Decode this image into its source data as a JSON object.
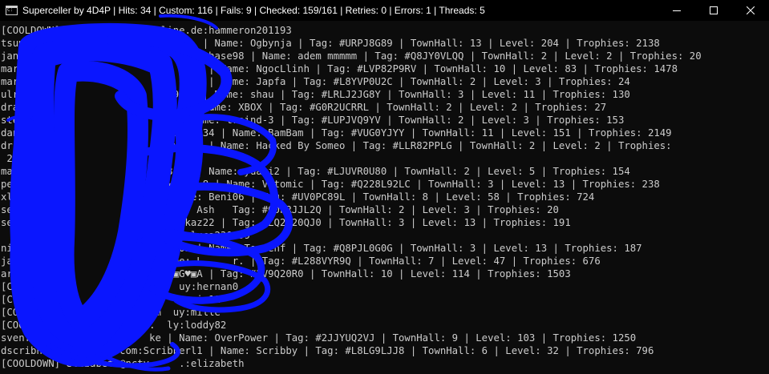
{
  "window": {
    "title": "Superceller by 4D4P | Hits: 34 | Custom: 116 | Fails: 9 | Checked: 159/161 | Retries: 0 | Errors: 1 | Threads: 5",
    "icon": "console-app-icon",
    "controls": [
      "minimize-icon",
      "maximize-icon",
      "close-icon"
    ]
  },
  "console": {
    "text_color": "#cccccc",
    "background": "#0c0c0c",
    "lines": [
      "[COOLDOWN] mar        0t-online.de:hammeron201193",
      "tsum                              | Name: Ogbynja | Tag: #URPJ8G89 | TownHall: 13 | Level: 204 | Trophies: 2138",
      "janni                           perhase98 | Name: adem mmmmm | Tag: #Q8JY0VLQQ | TownHall: 2 | Level: 2 | Trophies: 20",
      "marce                           :1 | Name: NgocLlinh | Tag: #LVP82P9RV | TownHall: 10 | Level: 83 | Trophies: 1478",
      "marce                         0909 | Name: Japfa | Tag: #L8YVP0U2C | TownHall: 2 | Level: 3 | Trophies: 24",
      "ulric                        9815 | Name: shau | Tag: #LRLJ2JG8Y | TownHall: 3 | Level: 11 | Trophies: 130",
      "drax-                         2 | Name: XBOX | Tag: #G0R2UCRRL | TownHall: 2 | Level: 2 | Trophies: 27",
      "stei                          | Name: traind-3 | Tag: #LUPJVQ9YV | TownHall: 2 | Level: 3 | Trophies: 153",
      "dani                        eppe1234 | Name: BamBam | Tag: #VUG0YJYY | TownHall: 11 | Level: 151 | Trophies: 2149",
      "dr.c                       ddulle2 | Name: Hacked By Someo | Tag: #LLR82PPLG | TownHall: 2 | Level: 2 | Trophies:",
      " 21",
      "mat                      rel31st | Name: yuaki2 | Tag: #LJUVR0U80 | TownHall: 2 | Level: 5 | Trophies: 154",
      "pe                        6xx11   8 | Name: Vatomic | Tag: #Q228L92LC | TownHall: 3 | Level: 13 | Trophies: 238",
      "xl                       6 | Name: Beni06 | Tag: #UV0PC89L | TownHall: 8 | Level: 58 | Trophies: 724",
      "se                       | Name: Ash   Tag: #Q0PRJJL2Q | TownHall: 2 | Level: 3 | Trophies: 20",
      "se                       ag: pokaz22 | Tag: #LQ2920QJ0 | TownHall: 3 | Level: 13 | Trophies: 191",
      "                         ine.de:luca230 99",
      "nico                     nno1503 | Name: Torrenf | Tag: #Q8PJL0G0G | TownHall: 3 | Level: 13 | Trophies: 187",
      "janwi                    | Name: L     r. | Tag: #L288VYR9Q | TownHall: 7 | Level: 47 | Trophies: 676",
      "arman                    ♥▣♥♥▣G♥▣A | Tag: #2V9Q20R0 | TownHall: 10 | Level: 114 | Trophies: 1503",
      "[COOLDOWN]               de   uy:hernan0",
      "[COOLDOW                 om   uq in11",
      "[COOLDOW                 om  uy:mille",
      "[COOLDOWN]               .  ly:loddy82",
      "svenfischer.7@           ke | Name: OverPower | Tag: #2JJYUQ2VJ | TownHall: 9 | Level: 103 | Trophies: 1250",
      "dscribner2@mine.   .com:Scribberl1 | Name: Scribby | Tag: #L8LG9LJJ8 | TownHall: 6 | Level: 32 | Trophies: 796",
      "[COOLDOWN] elizabeth@nctv.    .:elizabeth"
    ]
  },
  "redaction": {
    "color": "#0a16ff",
    "shape": "scribble-redaction"
  }
}
